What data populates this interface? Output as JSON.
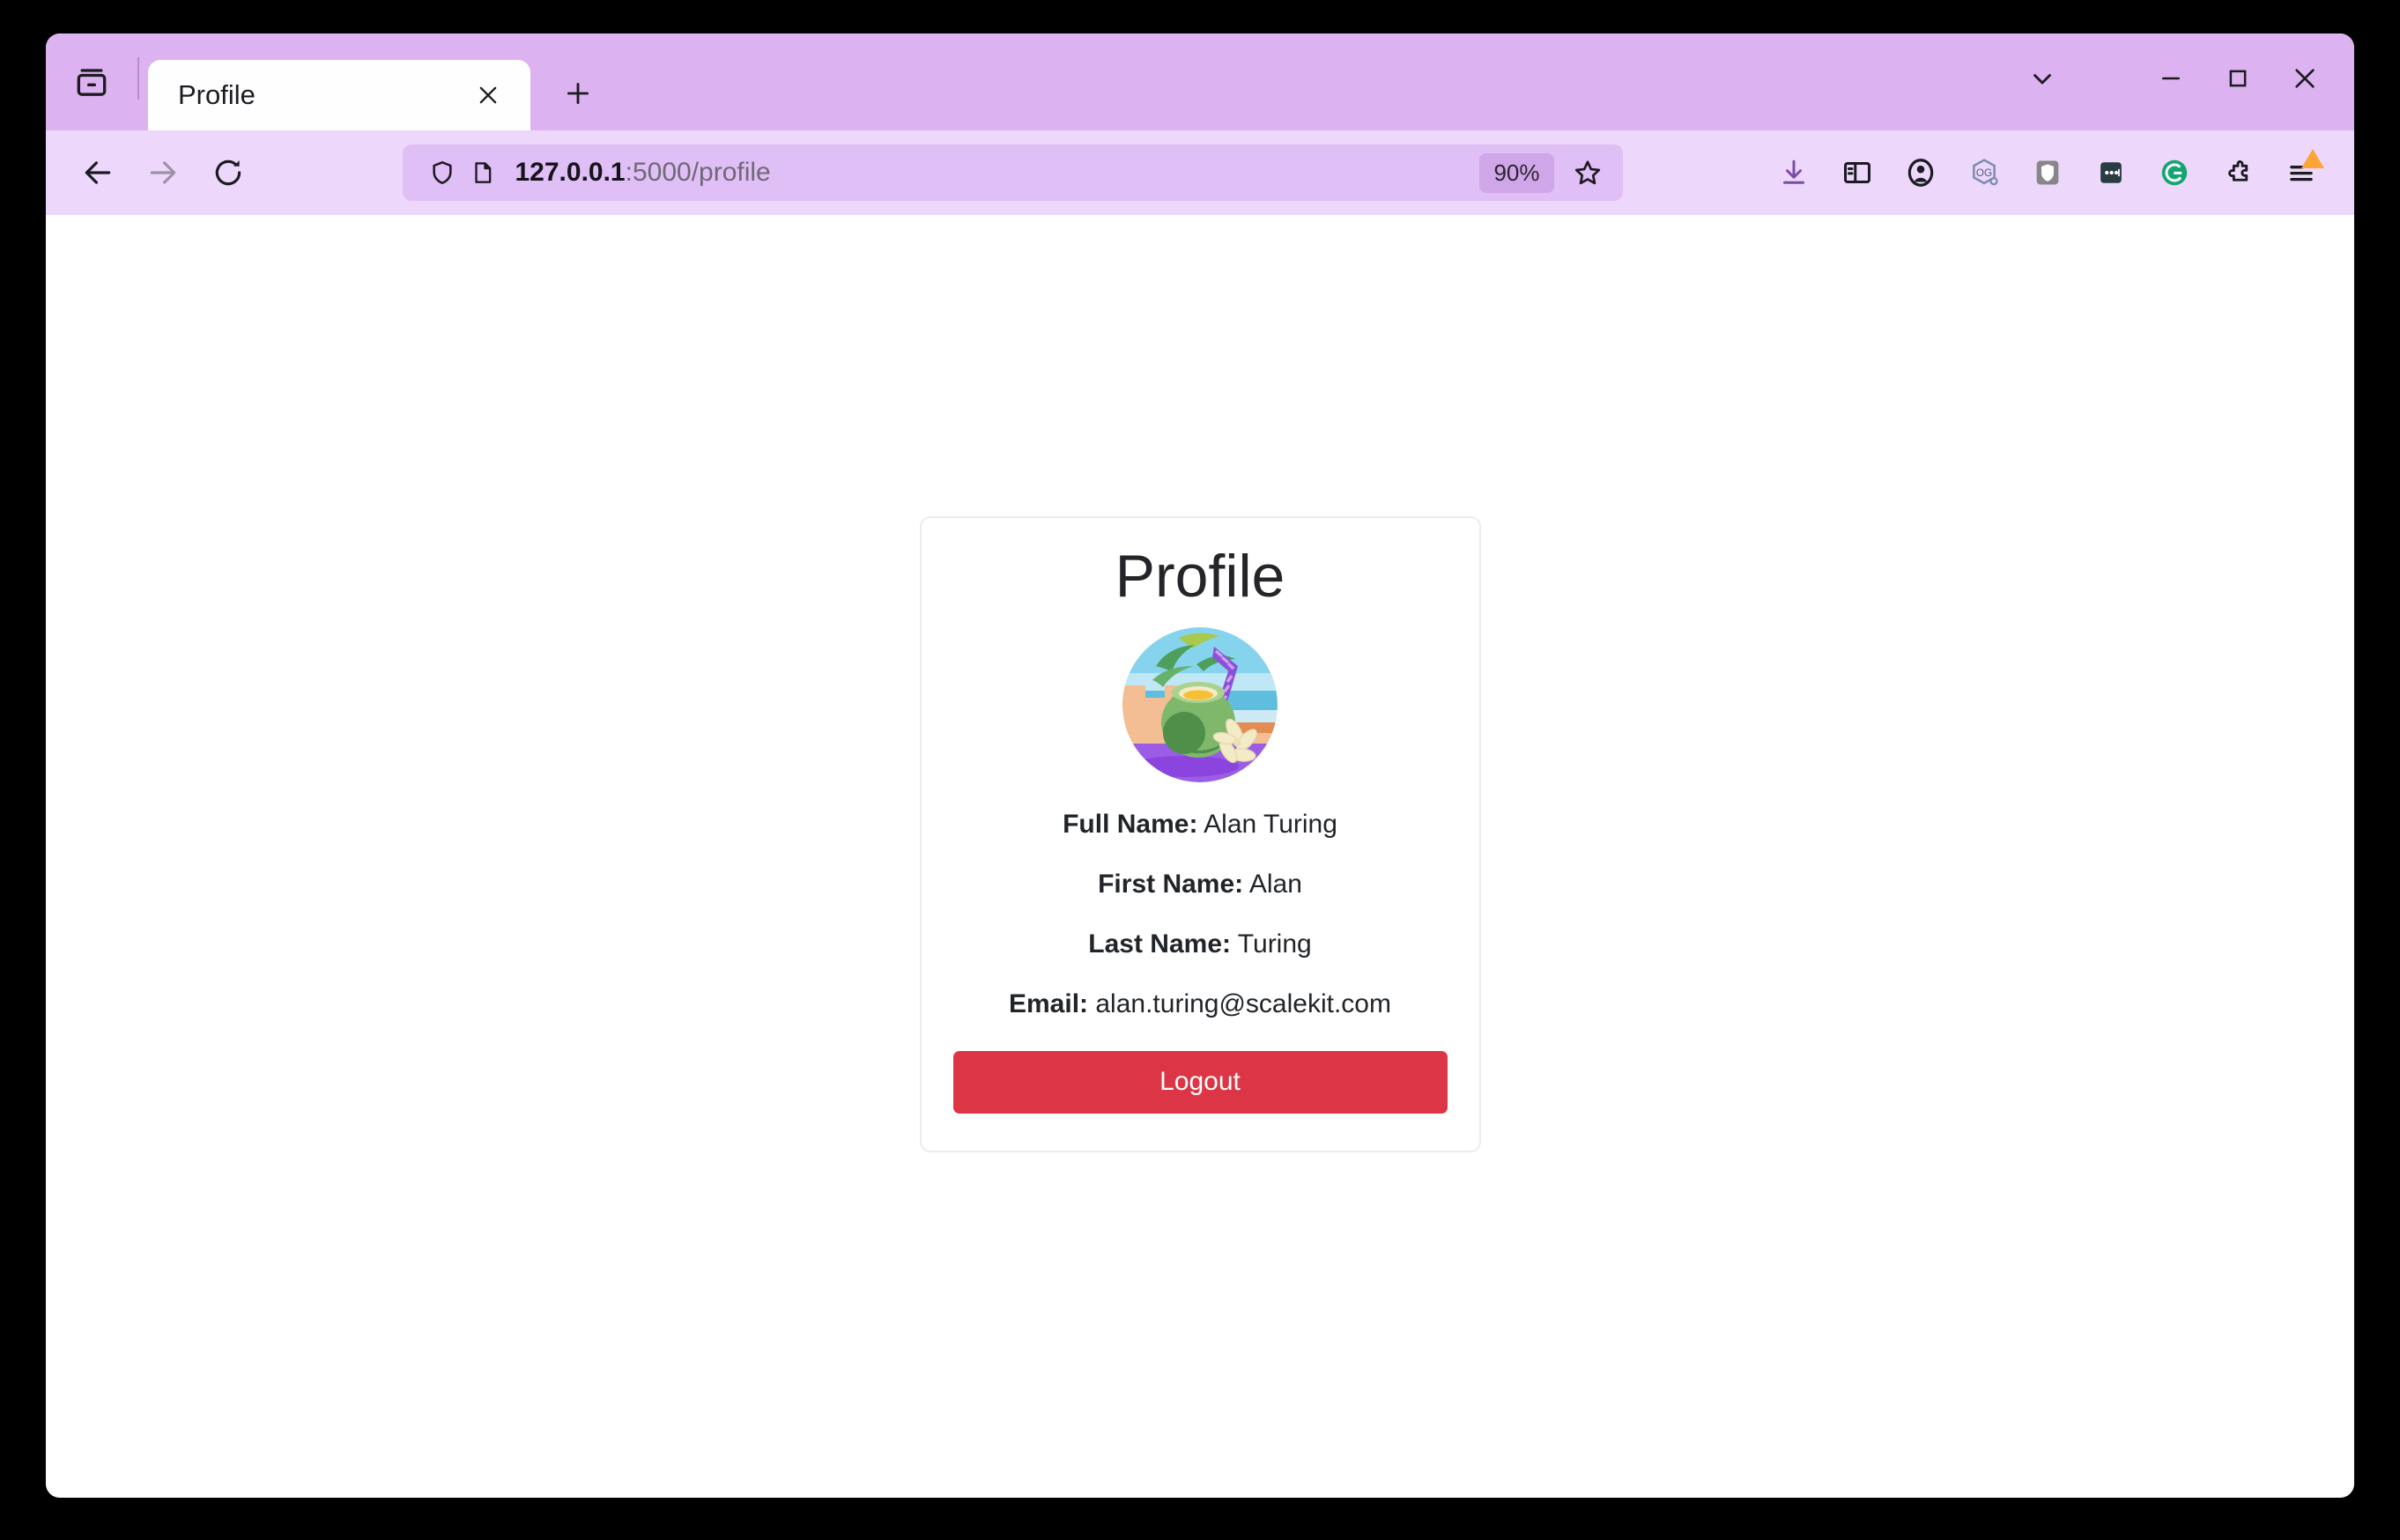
{
  "window": {
    "tab_title": "Profile",
    "controls": {
      "tablist_icon": "chevron-down-icon",
      "minimize_icon": "minimize-icon",
      "maximize_icon": "maximize-icon",
      "close_icon": "close-icon"
    }
  },
  "navigation": {
    "back_icon": "back-arrow-icon",
    "forward_icon": "forward-arrow-icon",
    "reload_icon": "reload-icon"
  },
  "urlbar": {
    "shield_icon": "shield-icon",
    "page_icon": "page-icon",
    "host": "127.0.0.1",
    "path": ":5000/profile",
    "full_url": "127.0.0.1:5000/profile",
    "zoom_level": "90%",
    "bookmark_icon": "star-icon"
  },
  "toolbar_extensions": [
    {
      "name": "downloads-icon",
      "label": "Downloads"
    },
    {
      "name": "sidebar-icon",
      "label": "Sidebars"
    },
    {
      "name": "account-icon",
      "label": "Account"
    },
    {
      "name": "og-badge-icon",
      "label": "OG"
    },
    {
      "name": "ublock-shield-icon",
      "label": "uBlock Origin"
    },
    {
      "name": "dots-extension-icon",
      "label": "Extension"
    },
    {
      "name": "grammarly-icon",
      "label": "G"
    },
    {
      "name": "puzzle-extensions-icon",
      "label": "Extensions"
    },
    {
      "name": "app-menu-icon",
      "label": "Open application menu"
    }
  ],
  "page": {
    "title": "Profile",
    "avatar_icon": "coconut-beach-avatar",
    "fields": [
      {
        "label": "Full Name:",
        "value": "Alan Turing"
      },
      {
        "label": "First Name:",
        "value": "Alan"
      },
      {
        "label": "Last Name:",
        "value": "Turing"
      },
      {
        "label": "Email:",
        "value": "alan.turing@scalekit.com"
      }
    ],
    "logout_label": "Logout"
  },
  "colors": {
    "titlebar": "#DDB2F0",
    "toolbar": "#EDD8FB",
    "urlbar_field": "#E0BEF6",
    "logout_button": "#DC3545",
    "card_border": "#ececec",
    "badge": "#FFA436"
  }
}
